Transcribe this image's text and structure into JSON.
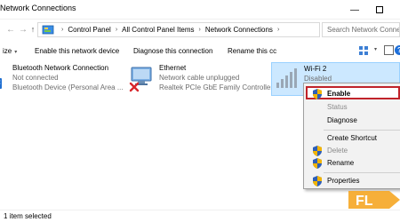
{
  "window": {
    "title": "Network Connections",
    "minimize_icon": "minimize-icon",
    "maximize_icon": "maximize-icon",
    "close_icon": "close-icon"
  },
  "address_bar": {
    "crumbs": [
      "Control Panel",
      "All Control Panel Items",
      "Network Connections"
    ],
    "search_placeholder": "Search Network Conne"
  },
  "command_bar": {
    "organize": "ize",
    "enable": "Enable this network device",
    "diagnose": "Diagnose this connection",
    "rename": "Rename this cc"
  },
  "connections": [
    {
      "name": "Bluetooth Network Connection",
      "status": "Not connected",
      "device": "Bluetooth Device (Personal Area ..."
    },
    {
      "name": "Ethernet",
      "status": "Network cable unplugged",
      "device": "Realtek PCIe GbE Family Controller"
    },
    {
      "name": "Wi-Fi 2",
      "status": "Disabled"
    }
  ],
  "context_menu": {
    "enable": "Enable",
    "status": "Status",
    "diagnose": "Diagnose",
    "create_shortcut": "Create Shortcut",
    "delete": "Delete",
    "rename": "Rename",
    "properties": "Properties"
  },
  "status_bar": {
    "count": "1 item selected",
    "items_prefix": "1"
  },
  "colors": {
    "selection": "#cce8ff",
    "selection_border": "#99d1ff",
    "enable_highlight": "#c0232a",
    "disabled_text": "#8a8a8a"
  }
}
